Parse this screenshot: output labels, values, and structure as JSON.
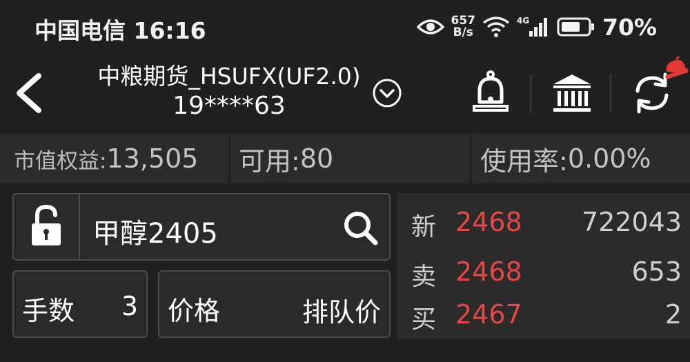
{
  "status_bar": {
    "carrier_time": "中国电信 16:16",
    "net_speed_value": "657",
    "net_speed_unit": "B/s",
    "network_type": "4G",
    "battery": "70%"
  },
  "header": {
    "title": "中粮期货_HSUFX(UF2.0)",
    "account": "19****63"
  },
  "account_summary": {
    "equity_label": "市值权益:",
    "equity_value": "13,505",
    "available_label": "可用:",
    "available_value": "80",
    "usage_label": "使用率:",
    "usage_value": "0.00%"
  },
  "order_form": {
    "contract": "甲醇2405",
    "lots_label": "手数",
    "lots_value": "3",
    "price_label": "价格",
    "price_value": "排队价"
  },
  "quote": {
    "rows": [
      {
        "label": "新",
        "price": "2468",
        "volume": "722043"
      },
      {
        "label": "卖",
        "price": "2468",
        "volume": "653"
      },
      {
        "label": "买",
        "price": "2467",
        "volume": "2"
      }
    ]
  },
  "colors": {
    "background": "#202020",
    "panel": "#2b2b2b",
    "price_red": "#e84545",
    "badge_red": "#e53935"
  },
  "icons": [
    "eye-icon",
    "wifi-icon",
    "signal-icon",
    "battery-icon",
    "back-arrow-icon",
    "chevron-down-circle-icon",
    "bell-icon",
    "bank-icon",
    "refresh-icon",
    "alarm-badge-icon",
    "unlock-icon",
    "search-icon"
  ]
}
